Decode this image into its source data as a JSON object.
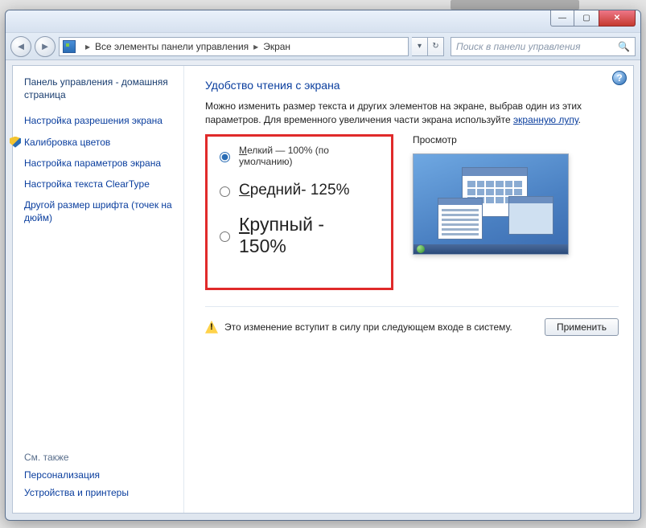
{
  "window_controls": {
    "min": "—",
    "max": "▢",
    "close": "✕"
  },
  "breadcrumb": {
    "seg1": "Все элементы панели управления",
    "seg2": "Экран"
  },
  "search": {
    "placeholder": "Поиск в панели управления"
  },
  "sidebar": {
    "home": "Панель управления - домашняя страница",
    "links": [
      "Настройка разрешения экрана",
      "Калибровка цветов",
      "Настройка параметров экрана",
      "Настройка текста ClearType",
      "Другой размер шрифта (точек на дюйм)"
    ],
    "see_also_hdr": "См. также",
    "see_also": [
      "Персонализация",
      "Устройства и принтеры"
    ]
  },
  "main": {
    "title": "Удобство чтения с экрана",
    "desc_before": "Можно изменить размер текста и других элементов на экране, выбрав один из этих параметров. Для временного увеличения части экрана используйте ",
    "desc_link": "экранную лупу",
    "desc_after": ".",
    "options": {
      "small_u": "М",
      "small_rest": "елкий — 100% (по умолчанию)",
      "medium_u": "С",
      "medium_rest": "редний- 125%",
      "large_u": "К",
      "large_rest": "рупный - 150%"
    },
    "preview_label": "Просмотр",
    "warn": "Это изменение вступит в силу при следующем входе в систему.",
    "apply": "Применить"
  }
}
